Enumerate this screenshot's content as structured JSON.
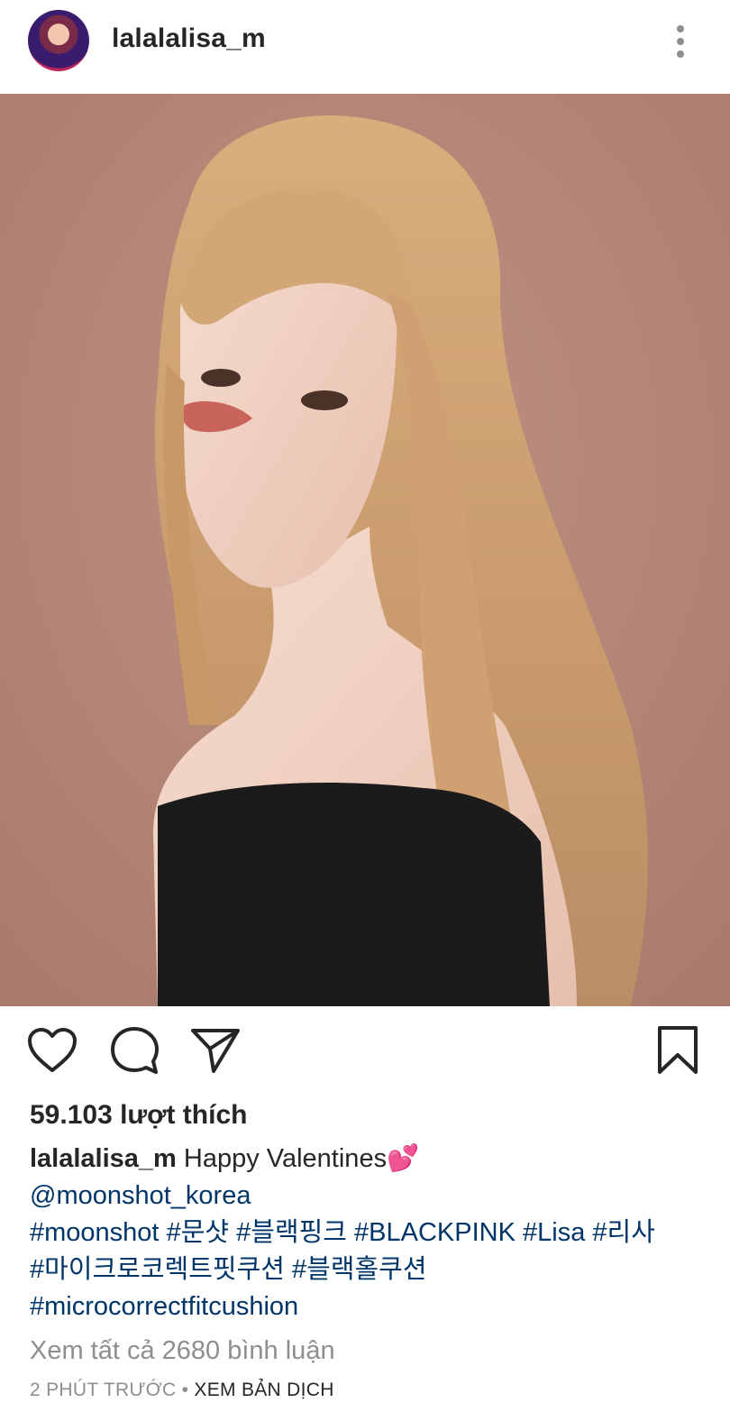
{
  "post": {
    "username": "lalalalisa_m",
    "likes_text": "59.103 lượt thích",
    "caption": {
      "username": "lalalalisa_m",
      "text": "Happy Valentines",
      "emoji": "💕",
      "mention": "@moonshot_korea",
      "hashtags_line1": [
        "#moonshot",
        "#문샷",
        "#블랙핑크",
        "#BLACKPINK",
        "#Lisa",
        "#리사"
      ],
      "hashtags_line2": [
        "#마이크로코렉트핏쿠션",
        "#블랙홀쿠션"
      ],
      "hashtags_line3": [
        "#microcorrectfitcushion"
      ]
    },
    "view_comments": "Xem tất cả 2680 bình luận",
    "time": "2 PHÚT TRƯỚC",
    "separator": "•",
    "translate": "XEM BẢN DỊCH"
  },
  "icons": {
    "more": "more-vertical-icon",
    "like": "heart-icon",
    "comment": "comment-icon",
    "share": "send-icon",
    "save": "bookmark-icon"
  },
  "colors": {
    "text": "#262626",
    "muted": "#8e8e8e",
    "link": "#003569",
    "photo_background": "#b5887a"
  }
}
